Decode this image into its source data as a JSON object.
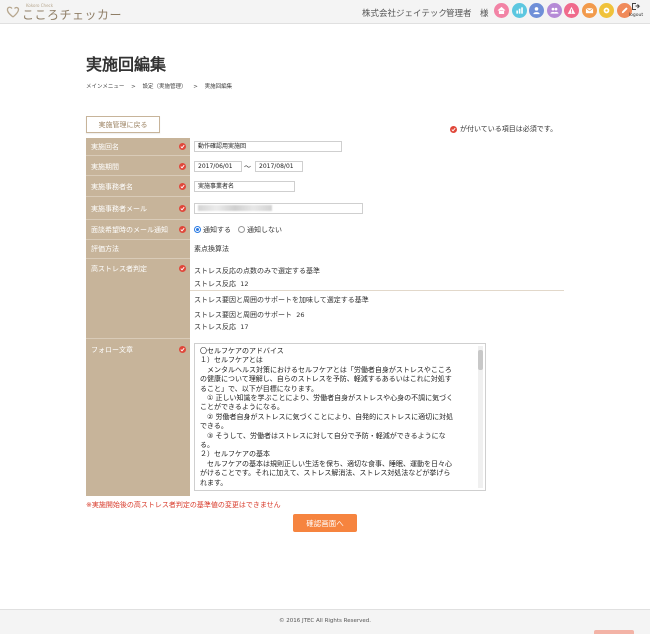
{
  "header": {
    "logo_sub": "Kokoro Check",
    "logo_text": "こころチェッカー",
    "company": "株式会社ジェイテック",
    "admin": "管理者　様",
    "logout_label": "logout",
    "nav_icons": [
      {
        "name": "home-icon",
        "color": "#f283a5"
      },
      {
        "name": "chart-icon",
        "color": "#5cc7e0"
      },
      {
        "name": "person-icon",
        "color": "#6f8fd8"
      },
      {
        "name": "group-icon",
        "color": "#b58ad6"
      },
      {
        "name": "warning-icon",
        "color": "#f06b8c"
      },
      {
        "name": "mail-icon",
        "color": "#f29a4b"
      },
      {
        "name": "gear-icon",
        "color": "#f0c23a"
      },
      {
        "name": "pencil-icon",
        "color": "#f08a5a"
      }
    ]
  },
  "page": {
    "title": "実施回編集",
    "breadcrumb": [
      "メインメニュー",
      "設定（実施管理）",
      "実施回編集"
    ],
    "breadcrumb_sep": ">",
    "back_button": "実施管理に戻る",
    "required_note": "が付いている項目は必須です。"
  },
  "form": {
    "name_label": "実施回名",
    "name_value": "動作確認用実施回",
    "period_label": "実施期間",
    "period_start": "2017/06/01",
    "period_tilde": "〜",
    "period_end": "2017/08/01",
    "manager_label": "実施事務者名",
    "manager_value": "実施事業者名",
    "email_label": "実施事務者メール",
    "email_value": "",
    "notify_label": "面談希望時のメール通知",
    "notify_on": "通知する",
    "notify_off": "通知しない",
    "notify_selected": "通知する",
    "method_label": "評価方法",
    "method_value": "素点換算法",
    "judge_label": "高ストレス者判定",
    "judge_block1_title": "ストレス反応の点数のみで選定する基準",
    "judge_block1_line1_label": "ストレス反応",
    "judge_block1_line1_value": "12",
    "judge_block2_title": "ストレス要因と周囲のサポートを加味して選定する基準",
    "judge_block2_line1_label": "ストレス要因と周囲のサポート",
    "judge_block2_line1_value": "26",
    "judge_block2_line2_label": "ストレス反応",
    "judge_block2_line2_value": "17",
    "follow_label": "フォロー文章",
    "follow_lines": [
      "〇セルフケアのアドバイス",
      "１）セルフケアとは",
      "　メンタルヘルス対策におけるセルフケアとは「労働者自身がストレスやこころ",
      "の健康について理解し、自らのストレスを予防、軽減するあるいはこれに対処す",
      "ること」で、以下が目標になります。",
      "　① 正しい知識を学ぶことにより、労働者自身がストレスや心身の不調に気づく",
      "ことができるようになる。",
      "　② 労働者自身がストレスに気づくことにより、自発的にストレスに適切に対処",
      "できる。",
      "　③ そうして、労働者はストレスに対して自分で予防・軽減ができるようにな",
      "る。",
      "２）セルフケアの基本",
      "　セルフケアの基本は規則正しい生活を保ち、適切な食事、睡眠、運動を日々心",
      "がけることです。それに加えて、ストレス解消法、ストレス対処法などが挙げら",
      "れます。"
    ]
  },
  "warning": "※実施開始後の高ストレス者判定の基準値の変更はできません",
  "confirm_button": "確認画面へ",
  "footer": {
    "copyright": "© 2016 JTEC All Rights Reserved."
  }
}
